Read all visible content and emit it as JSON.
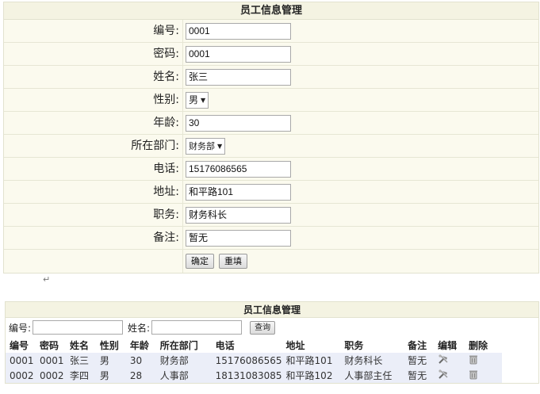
{
  "form": {
    "title": "员工信息管理",
    "fields": [
      {
        "label": "编号:",
        "value": "0001"
      },
      {
        "label": "密码:",
        "value": "0001"
      },
      {
        "label": "姓名:",
        "value": "张三"
      },
      {
        "label": "性别:",
        "value": "男"
      },
      {
        "label": "年龄:",
        "value": "30"
      },
      {
        "label": "所在部门:",
        "value": "财务部"
      },
      {
        "label": "电话:",
        "value": "15176086565"
      },
      {
        "label": "地址:",
        "value": "和平路101"
      },
      {
        "label": "职务:",
        "value": "财务科长"
      },
      {
        "label": "备注:",
        "value": "暂无"
      }
    ],
    "confirm_label": "确定",
    "reset_label": "重填"
  },
  "para_mark": "↵",
  "list": {
    "title": "员工信息管理",
    "search": {
      "id_label": "编号:",
      "name_label": "姓名:",
      "query_label": "查询"
    },
    "headers": [
      "编号",
      "密码",
      "姓名",
      "性别",
      "年龄",
      "所在部门",
      "电话",
      "地址",
      "职务",
      "备注",
      "编辑",
      "删除"
    ],
    "rows": [
      [
        "0001",
        "0001",
        "张三",
        "男",
        "30",
        "财务部",
        "15176086565",
        "和平路101",
        "财务科长",
        "暂无"
      ],
      [
        "0002",
        "0002",
        "李四",
        "男",
        "28",
        "人事部",
        "18131083085",
        "和平路102",
        "人事部主任",
        "暂无"
      ]
    ],
    "edit_icon": "edit-tools-icon",
    "delete_icon": "trash-icon"
  }
}
